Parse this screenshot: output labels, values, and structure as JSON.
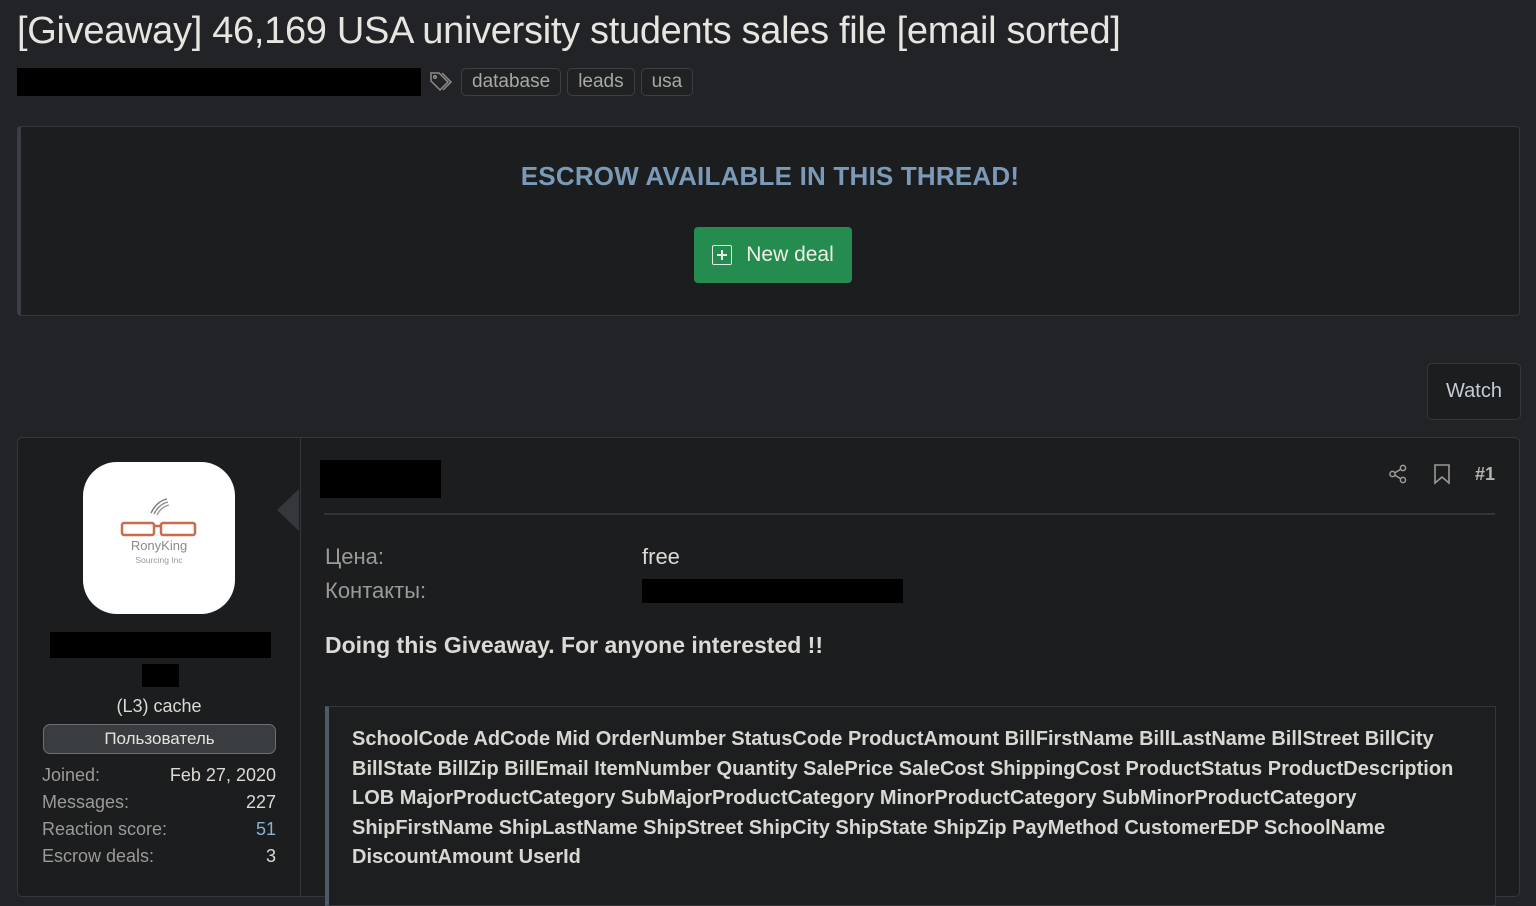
{
  "thread": {
    "title": "[Giveaway] 46,169 USA university students sales file [email sorted]",
    "tags": [
      "database",
      "leads",
      "usa"
    ]
  },
  "escrow": {
    "heading": "ESCROW AVAILABLE IN THIS THREAD!",
    "new_deal_label": "New deal"
  },
  "actions": {
    "watch_label": "Watch"
  },
  "post": {
    "number": "#1",
    "user": {
      "avatar_text_main": "RonyKing",
      "avatar_text_sub": "Sourcing Inc",
      "level": "(L3) cache",
      "banner": "Пользователь",
      "stats": [
        {
          "label": "Joined:",
          "value": "Feb 27, 2020"
        },
        {
          "label": "Messages:",
          "value": "227"
        },
        {
          "label": "Reaction score:",
          "value": "51"
        },
        {
          "label": "Escrow deals:",
          "value": "3"
        }
      ]
    },
    "fields": {
      "price_label": "Цена:",
      "price_value": "free",
      "contacts_label": "Контакты:"
    },
    "intro": "Doing this Giveaway. For anyone interested !!",
    "quote_text": "SchoolCode AdCode Mid OrderNumber StatusCode ProductAmount BillFirstName BillLastName BillStreet BillCity BillState BillZip BillEmail ItemNumber Quantity SalePrice SaleCost ShippingCost ProductStatus ProductDescription LOB MajorProductCategory SubMajorProductCategory MinorProductCategory SubMinorProductCategory ShipFirstName ShipLastName ShipStreet ShipCity ShipState ShipZip PayMethod CustomerEDP SchoolName DiscountAmount UserId"
  },
  "colors": {
    "accent_green": "#238c4e",
    "escrow_heading": "#7b9ab8",
    "background": "#222326",
    "panel": "#1b1d1f"
  }
}
